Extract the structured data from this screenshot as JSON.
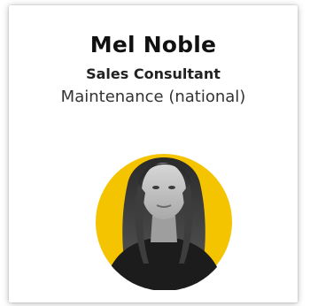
{
  "profile": {
    "name": "Mel Noble",
    "title": "Sales Consultant",
    "department": "Maintenance (national)"
  },
  "photo": {
    "description_icon": "portrait-photo",
    "accent_color": "#f5c400"
  }
}
